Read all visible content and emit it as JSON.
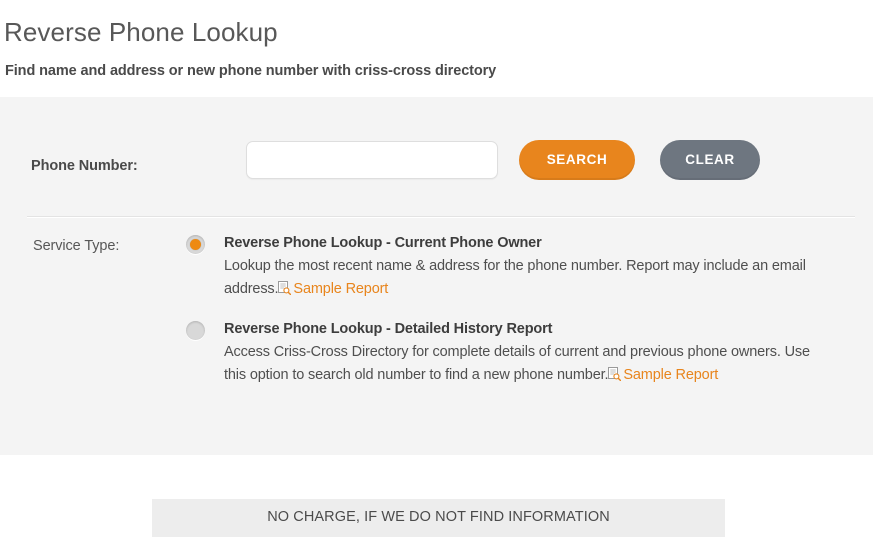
{
  "header": {
    "title": "Reverse Phone Lookup",
    "subtitle": "Find name and address or new phone number with criss-cross directory"
  },
  "form": {
    "phone_label": "Phone Number:",
    "phone_value": "",
    "phone_placeholder": "",
    "search_label": "SEARCH",
    "clear_label": "CLEAR",
    "service_label": "Service Type:",
    "options": [
      {
        "id": "current-phone-owner",
        "title": "Reverse Phone Lookup - Current Phone Owner",
        "desc": "Lookup the most recent name & address for the phone number. Report may include an email address.",
        "link_label": "Sample Report",
        "icon": "document-search-icon",
        "selected": true
      },
      {
        "id": "detailed-history-report",
        "title": "Reverse Phone Lookup - Detailed History Report",
        "desc": "Access Criss-Cross Directory for complete details of current and previous phone owners. Use this option to search old number to find a new phone number.",
        "link_label": "Sample Report",
        "icon": "document-search-icon",
        "selected": false
      }
    ]
  },
  "footer": {
    "no_charge_text": "NO CHARGE, IF WE DO NOT FIND INFORMATION"
  },
  "colors": {
    "accent_orange": "#e8851d",
    "clear_gray": "#6e7680",
    "panel_bg": "#f4f4f4",
    "footer_bg": "#ededed"
  }
}
